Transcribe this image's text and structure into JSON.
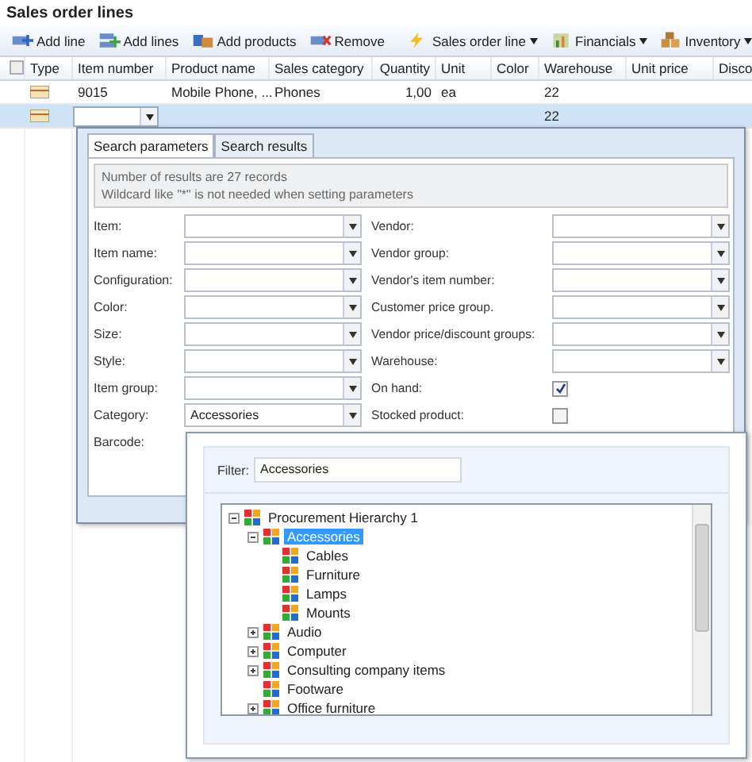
{
  "title": "Sales order lines",
  "toolbar": [
    {
      "label": "Add line",
      "kind": "button"
    },
    {
      "label": "Add lines",
      "kind": "button"
    },
    {
      "label": "Add products",
      "kind": "button"
    },
    {
      "label": "Remove",
      "kind": "button"
    },
    {
      "label": "Sales order line",
      "kind": "menu"
    },
    {
      "label": "Financials",
      "kind": "menu"
    },
    {
      "label": "Inventory",
      "kind": "menu"
    }
  ],
  "grid": {
    "select_all": {
      "checked": false
    },
    "columns": [
      "Type",
      "Item number",
      "Product name",
      "Sales category",
      "Quantity",
      "Unit",
      "Color",
      "Warehouse",
      "Unit price",
      "Disco"
    ],
    "rows": [
      {
        "selected": false,
        "kind": "text",
        "item_number": "9015",
        "product_name": "Mobile Phone, ...",
        "sales_category": "Phones",
        "quantity": "1,00",
        "unit": "ea",
        "warehouse": "22"
      },
      {
        "selected": true,
        "kind": "edit",
        "warehouse": "22"
      }
    ]
  },
  "search_popup": {
    "tabs": [
      {
        "label": "Search parameters",
        "selected": true
      },
      {
        "label": "Search results",
        "selected": false
      }
    ],
    "info": [
      "Number of results are 27 records",
      "Wildcard like \"*\" is not needed when setting parameters"
    ],
    "fields_left": [
      {
        "label": "Item:",
        "kind": "combo"
      },
      {
        "label": "Item name:",
        "kind": "combo"
      },
      {
        "label": "Configuration:",
        "kind": "combo"
      },
      {
        "label": "Color:",
        "kind": "combo"
      },
      {
        "label": "Size:",
        "kind": "combo"
      },
      {
        "label": "Style:",
        "kind": "combo"
      },
      {
        "label": "Item group:",
        "kind": "combo"
      },
      {
        "label": "Category:",
        "kind": "combo",
        "value": "Accessories"
      },
      {
        "label": "Barcode:",
        "kind": "label"
      }
    ],
    "fields_right": [
      {
        "label": "Vendor:",
        "kind": "combo"
      },
      {
        "label": "Vendor group:",
        "kind": "combo"
      },
      {
        "label": "Vendor's item number:",
        "kind": "combo"
      },
      {
        "label": "Customer price group.",
        "kind": "combo"
      },
      {
        "label": "Vendor price/discount groups:",
        "kind": "combo"
      },
      {
        "label": "Warehouse:",
        "kind": "combo"
      },
      {
        "label": "On hand:",
        "kind": "checkbox",
        "checked": true
      },
      {
        "label": "Stocked product:",
        "kind": "checkbox",
        "checked": false
      }
    ]
  },
  "filter_popup": {
    "label": "Filter:",
    "value": "Accessories",
    "tree": [
      {
        "label": "Procurement Hierarchy 1",
        "expanded": true,
        "selected": false,
        "children": [
          {
            "label": "Accessories",
            "expanded": true,
            "selected": true,
            "children": [
              {
                "label": "Cables",
                "selected": false
              },
              {
                "label": "Furniture",
                "selected": false
              },
              {
                "label": "Lamps",
                "selected": false
              },
              {
                "label": "Mounts",
                "selected": false
              }
            ]
          },
          {
            "label": "Audio",
            "expanded": false,
            "selected": false
          },
          {
            "label": "Computer",
            "expanded": false,
            "selected": false
          },
          {
            "label": "Consulting company items",
            "expanded": false,
            "selected": false
          },
          {
            "label": "Footware",
            "selected": false
          },
          {
            "label": "Office furniture",
            "expanded": false,
            "selected": false
          }
        ]
      }
    ]
  }
}
